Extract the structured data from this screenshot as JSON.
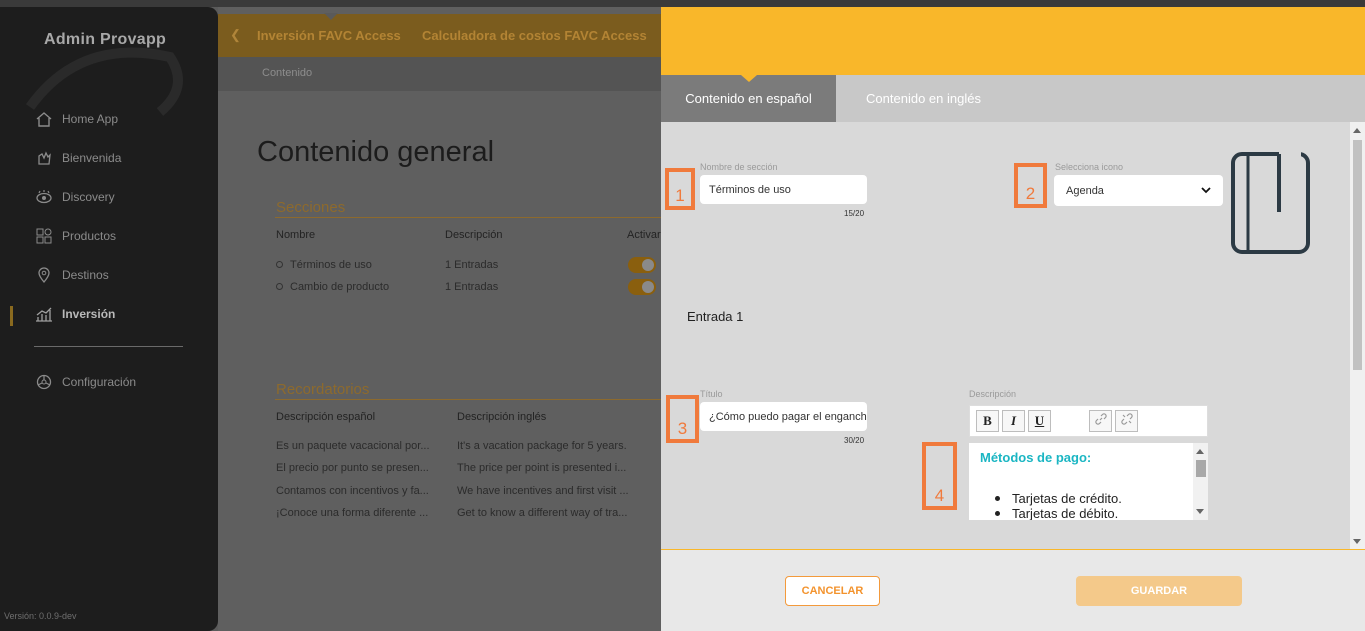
{
  "sidebar": {
    "title": "Admin Provapp",
    "items": [
      {
        "label": "Home App",
        "icon": "home-icon"
      },
      {
        "label": "Bienvenida",
        "icon": "wave-icon"
      },
      {
        "label": "Discovery",
        "icon": "eye-icon"
      },
      {
        "label": "Productos",
        "icon": "grid-icon"
      },
      {
        "label": "Destinos",
        "icon": "pin-icon"
      },
      {
        "label": "Inversión",
        "icon": "chart-icon",
        "active": true
      },
      {
        "label": "Configuración",
        "icon": "gear-icon"
      }
    ],
    "version": "Versión: 0.0.9-dev"
  },
  "main": {
    "tabs": [
      "Inversión FAVC Access",
      "Calculadora de costos FAVC Access"
    ],
    "breadcrumb": "Contenido",
    "title": "Contenido general",
    "secciones": {
      "title": "Secciones",
      "headers": [
        "Nombre",
        "Descripción",
        "Activar"
      ],
      "rows": [
        {
          "name": "Términos de uso",
          "desc": "1 Entradas"
        },
        {
          "name": "Cambio de producto",
          "desc": "1 Entradas"
        }
      ]
    },
    "recordatorios": {
      "title": "Recordatorios",
      "headers": [
        "Descripción español",
        "Descripción inglés"
      ],
      "rows": [
        [
          "Es un paquete vacacional por...",
          "It's a vacation package for 5 years."
        ],
        [
          "El precio por punto se presen...",
          "The price per point is presented i..."
        ],
        [
          "Contamos con incentivos y fa...",
          "We have incentives and first visit ..."
        ],
        [
          "¡Conoce una forma diferente ...",
          "Get to know a different way of tra..."
        ]
      ]
    }
  },
  "drawer": {
    "tabs": {
      "es": "Contenido en español",
      "en": "Contenido en inglés"
    },
    "section_name": {
      "label": "Nombre de sección",
      "value": "Términos de uso",
      "counter": "15/20"
    },
    "icon_select": {
      "label": "Selecciona icono",
      "value": "Agenda"
    },
    "entry_title": "Entrada 1",
    "titulo": {
      "label": "Título",
      "value": "¿Cómo puedo pagar el enganche?",
      "counter": "30/20"
    },
    "descripcion": {
      "label": "Descripción",
      "toolbar": {
        "bold": "B",
        "italic": "I",
        "underline": "U"
      },
      "heading": "Métodos de pago:",
      "items": [
        "Tarjetas de crédito.",
        "Tarjetas de débito."
      ]
    },
    "markers": [
      "1",
      "2",
      "3",
      "4"
    ],
    "cancel_label": "CANCELAR",
    "save_label": "GUARDAR"
  },
  "colors": {
    "accent": "#f9b72a",
    "marker": "#f07a3c",
    "editor_heading": "#1bb6c3"
  }
}
